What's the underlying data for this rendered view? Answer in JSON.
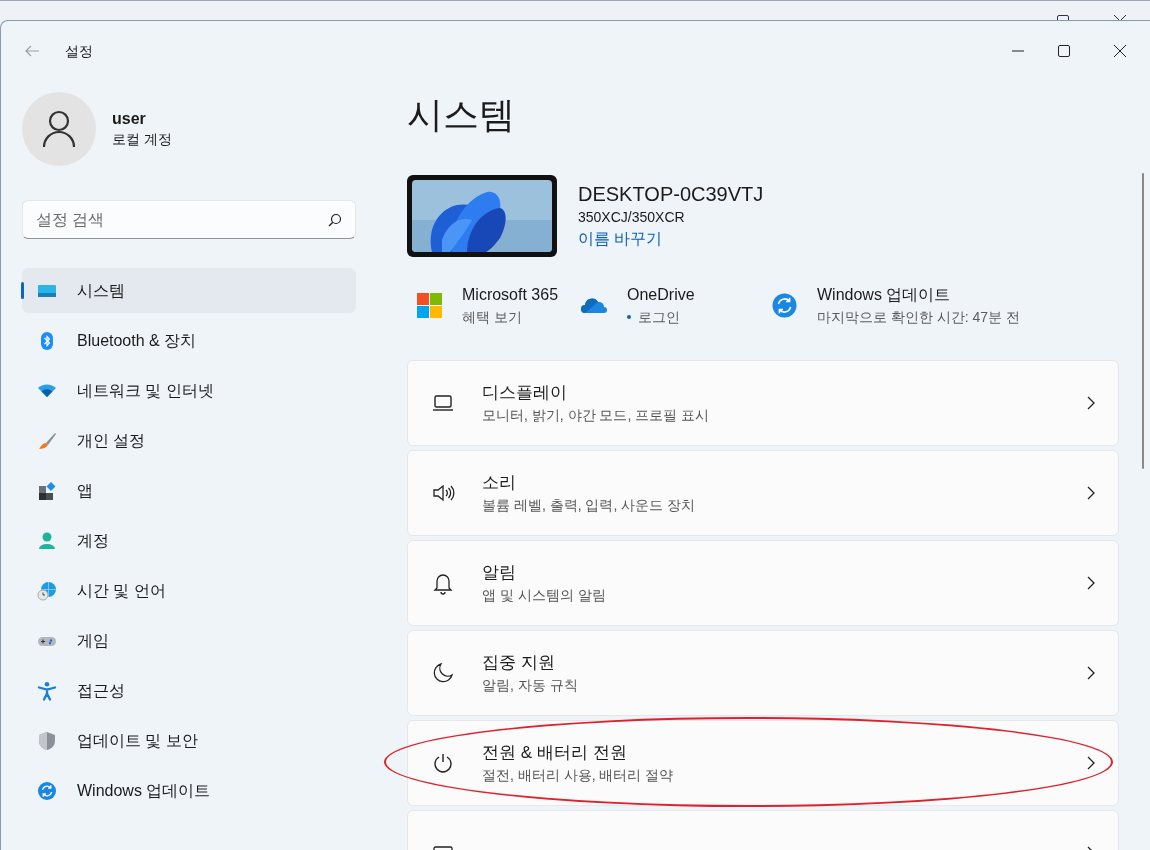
{
  "window": {
    "title": "설정"
  },
  "account": {
    "name": "user",
    "type": "로컬 계정"
  },
  "search": {
    "placeholder": "설정 검색"
  },
  "sidebar": {
    "items": [
      {
        "label": "시스템",
        "selected": true
      },
      {
        "label": "Bluetooth & 장치",
        "selected": false
      },
      {
        "label": "네트워크 및 인터넷",
        "selected": false
      },
      {
        "label": "개인 설정",
        "selected": false
      },
      {
        "label": "앱",
        "selected": false
      },
      {
        "label": "계정",
        "selected": false
      },
      {
        "label": "시간 및 언어",
        "selected": false
      },
      {
        "label": "게임",
        "selected": false
      },
      {
        "label": "접근성",
        "selected": false
      },
      {
        "label": "업데이트 및 보안",
        "selected": false
      },
      {
        "label": "Windows 업데이트",
        "selected": false
      }
    ]
  },
  "page": {
    "title": "시스템",
    "device": {
      "name": "DESKTOP-0C39VTJ",
      "model": "350XCJ/350XCR",
      "rename_link": "이름 바꾸기"
    },
    "quick_links": [
      {
        "title": "Microsoft 365",
        "subtitle": "혜택 보기",
        "dot": false
      },
      {
        "title": "OneDrive",
        "subtitle": "로그인",
        "dot": true
      },
      {
        "title": "Windows 업데이트",
        "subtitle": "마지막으로 확인한 시간: 47분 전",
        "dot": false
      }
    ],
    "settings": [
      {
        "title": "디스플레이",
        "subtitle": "모니터, 밝기, 야간 모드, 프로필 표시",
        "circled": false
      },
      {
        "title": "소리",
        "subtitle": "볼륨 레벨, 출력, 입력, 사운드 장치",
        "circled": false
      },
      {
        "title": "알림",
        "subtitle": "앱 및 시스템의 알림",
        "circled": false
      },
      {
        "title": "집중 지원",
        "subtitle": "알림, 자동 규칙",
        "circled": false
      },
      {
        "title": "전원 & 배터리 전원",
        "subtitle": "절전, 배터리 사용, 배터리 절약",
        "circled": true
      },
      {
        "circled": false
      }
    ]
  }
}
